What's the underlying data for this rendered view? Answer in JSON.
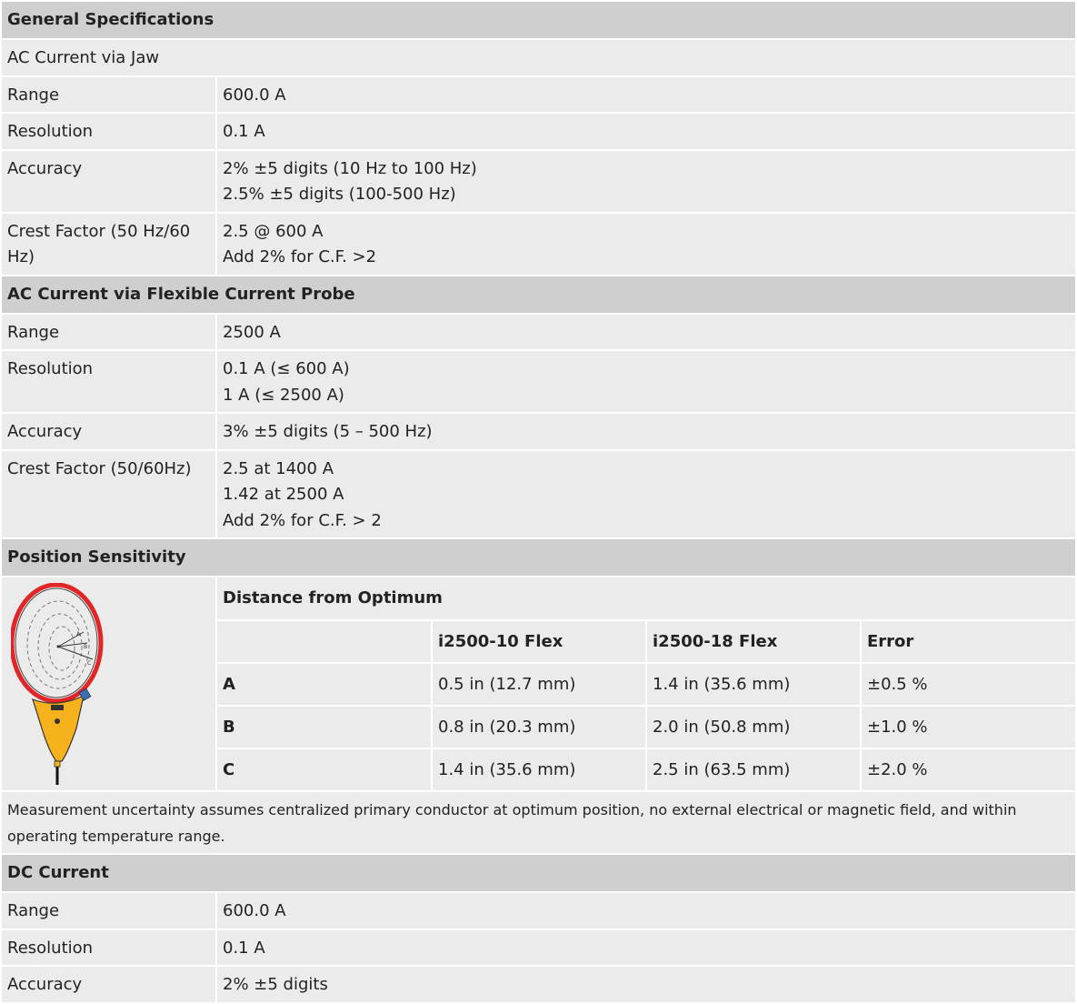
{
  "sections": {
    "general": {
      "title": "General Specifications",
      "subtitle": "AC Current via Jaw",
      "rows": [
        {
          "label": "Range",
          "lines": [
            "600.0 A"
          ]
        },
        {
          "label": "Resolution",
          "lines": [
            "0.1 A"
          ]
        },
        {
          "label": "Accuracy",
          "lines": [
            "2% ±5 digits (10 Hz to 100 Hz)",
            "2.5% ±5 digits (100-500 Hz)"
          ]
        },
        {
          "label": "Crest Factor (50 Hz/60 Hz)",
          "lines": [
            "2.5 @ 600 A",
            "Add 2% for C.F. >2"
          ]
        }
      ]
    },
    "flex": {
      "title": "AC Current via Flexible Current Probe",
      "rows": [
        {
          "label": "Range",
          "lines": [
            "2500 A"
          ]
        },
        {
          "label": "Resolution",
          "lines": [
            "0.1 A (≤ 600 A)",
            "1 A (≤ 2500 A)"
          ]
        },
        {
          "label": "Accuracy",
          "lines": [
            "3% ±5 digits (5 – 500 Hz)"
          ]
        },
        {
          "label": "Crest Factor (50/60Hz)",
          "lines": [
            "2.5 at 1400 A",
            "1.42 at 2500 A",
            "Add 2% for C.F. > 2"
          ]
        }
      ]
    },
    "position": {
      "title": "Position Sensitivity",
      "distance_title": "Distance from Optimum",
      "headers": [
        "",
        "i2500-10 Flex",
        "i2500-18 Flex",
        "Error"
      ],
      "rows": [
        {
          "pos": "A",
          "flex10": "0.5 in (12.7 mm)",
          "flex18": "1.4 in (35.6 mm)",
          "error": "±0.5 %"
        },
        {
          "pos": "B",
          "flex10": "0.8 in (20.3 mm)",
          "flex18": "2.0 in (50.8 mm)",
          "error": "±1.0 %"
        },
        {
          "pos": "C",
          "flex10": "1.4 in (35.6 mm)",
          "flex18": "2.5 in (63.5 mm)",
          "error": "±2.0 %"
        }
      ],
      "note": "Measurement uncertainty assumes centralized primary conductor at optimum position, no external electrical or magnetic field, and within operating temperature range."
    },
    "dc": {
      "title": "DC Current",
      "rows": [
        {
          "label": "Range",
          "lines": [
            "600.0 A"
          ]
        },
        {
          "label": "Resolution",
          "lines": [
            "0.1 A"
          ]
        },
        {
          "label": "Accuracy",
          "lines": [
            "2% ±5 digits"
          ]
        }
      ]
    }
  },
  "colors": {
    "header_bg": "#cfcfcf",
    "row_bg": "#ebebeb",
    "border": "#ffffff",
    "probe_red": "#e02626",
    "probe_yellow": "#f5b21c"
  }
}
